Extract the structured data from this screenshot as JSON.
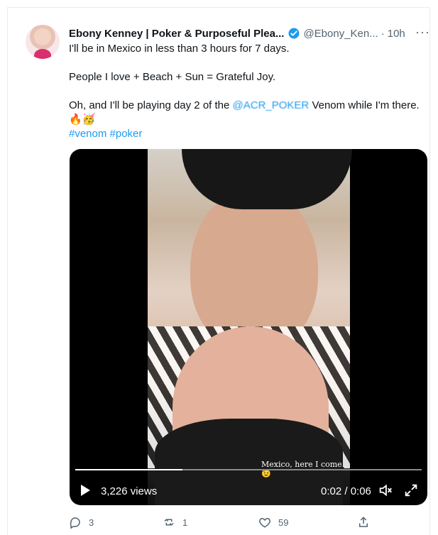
{
  "tweet": {
    "display_name": "Ebony Kenney | Poker & Purposeful Plea...",
    "handle": "@Ebony_Ken...",
    "separator": "·",
    "time": "10h",
    "more": "···",
    "line1": "I'll be in Mexico in less than 3 hours for 7 days.",
    "line2": "People I love + Beach + Sun = Grateful Joy.",
    "line3_prefix": "Oh, and I'll be playing day 2 of the ",
    "mention": "@ACR_POKER",
    "line3_suffix": " Venom while I'm there.",
    "emoji": "🔥🥳",
    "hashtags": "#venom #poker"
  },
  "video": {
    "caption": "Mexico, here I come..😉",
    "views": "3,226 views",
    "timecode": "0:02 / 0:06",
    "progress": 0.31
  },
  "actions": {
    "replies": "3",
    "retweets": "1",
    "likes": "59"
  },
  "colors": {
    "accent": "#1d9bf0",
    "muted": "#536471",
    "video_bg": "#000000"
  },
  "icons": [
    "verified-badge-icon",
    "more-icon",
    "play-icon",
    "mute-icon",
    "fullscreen-icon",
    "reply-icon",
    "retweet-icon",
    "like-icon",
    "share-icon"
  ]
}
